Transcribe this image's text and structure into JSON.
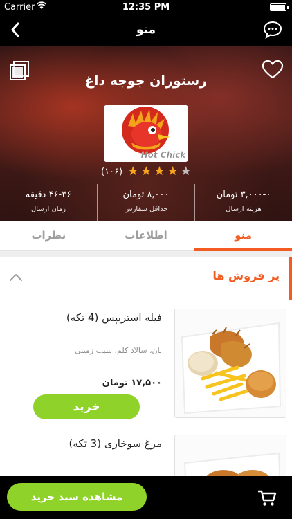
{
  "status_bar": {
    "carrier": "Carrier",
    "time": "12:35 PM"
  },
  "nav": {
    "title": "منو"
  },
  "restaurant": {
    "name": "رستوران جوجه داغ",
    "logo_text": "Hot Chick",
    "rating": {
      "count": "(۱۰۶)",
      "stars_filled": 4,
      "stars_total": 5
    }
  },
  "stats": [
    {
      "value": "۳,۰۰۰-۰ تومان",
      "label": "هزینه ارسال"
    },
    {
      "value": "۸,۰۰۰ تومان",
      "label": "حداقل سفارش"
    },
    {
      "value": "۴۶-۳۶ دقیقه",
      "label": "زمان ارسال"
    }
  ],
  "tabs": [
    {
      "label": "منو",
      "active": true
    },
    {
      "label": "اطلاعات",
      "active": false
    },
    {
      "label": "نظرات",
      "active": false
    }
  ],
  "category": {
    "title": "پر فروش ها"
  },
  "items": [
    {
      "name": "فیله استریپس (4 تکه)",
      "description": "نان، سالاد کلم، سیب زمینی",
      "price": "۱۷,۵۰۰ تومان",
      "buy_label": "خرید"
    },
    {
      "name": "مرغ سوخاری (3 تکه)"
    }
  ],
  "bottom_bar": {
    "cart_label": "مشاهده سبد خرید"
  },
  "colors": {
    "accent": "#f25c22",
    "green": "#8fd32a",
    "star": "#f7a61c"
  }
}
